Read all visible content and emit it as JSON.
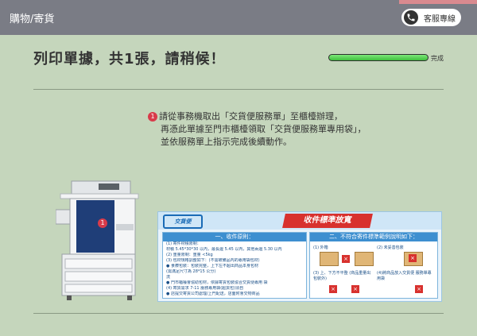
{
  "topbar": {
    "title": "購物/寄貨",
    "service_label": "客服專線"
  },
  "headline": "列印單據，共1張，請稍候！",
  "progress": {
    "label": "完成",
    "fraction": 1.0
  },
  "instruction": {
    "step": "1",
    "lines": [
      "請從事務機取出「交貨便服務單」至櫃檯辦理，",
      "再憑此單據至門市櫃檯領取「交貨便服務單專用袋」，",
      "並依服務單上指示完成後續動作。"
    ]
  },
  "printer": {
    "step": "1"
  },
  "poster": {
    "logo": "交貨便",
    "title": "收件標準放寬",
    "left_header": "一、收件原則：",
    "left_lines": [
      "(1) 寄件材積限制：",
      "材積 5.45*30*30 以內，最長邊 5.45 以內，其他兩邊 5.30 以內",
      "(2) 重量限制：重量 <5kg",
      "(3) 包材規格調整如下：(不需被備品內的專用袋包材)",
      "● 食療包裝：包裝完整，上下左不超出商品本身包材",
      "(需滿足尺寸為 28*15 公分)",
      "流",
      "● 門市櫃檯會協助包材，依據寄貨包裝協合交貨便專用 袋",
      "(4) 寄貨需求 7-11 服務專用袋(超貨包)須自",
      "● 店提交寄貨公司處理/上門配送，店面附會交物商品"
    ],
    "right_header": "二、不符合寄件標準範例說明如下：",
    "right_items": [
      "(1) 外箱",
      "(2) 未妥善包裝",
      "(3) 上、下方不平整 (商品重量出包裝外)",
      "(4)將商品放入交貨便 服務單專用袋"
    ]
  }
}
